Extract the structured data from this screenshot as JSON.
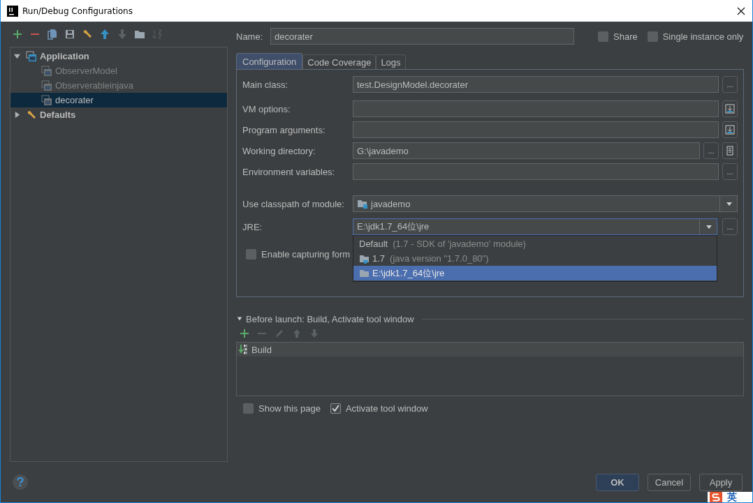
{
  "window": {
    "title": "Run/Debug Configurations"
  },
  "toolbar": [
    {
      "kind": "add",
      "disabled": false
    },
    {
      "kind": "remove",
      "disabled": false
    },
    {
      "kind": "copy",
      "disabled": false
    },
    {
      "kind": "save",
      "disabled": false
    },
    {
      "kind": "wrench",
      "disabled": false
    },
    {
      "kind": "up",
      "disabled": false
    },
    {
      "kind": "down",
      "disabled": true
    },
    {
      "kind": "folder",
      "disabled": false
    },
    {
      "kind": "sort",
      "disabled": true
    }
  ],
  "tree": [
    {
      "label": "Application",
      "kind": "application",
      "expanded": true,
      "selected": false,
      "children": [
        {
          "label": "ObserverModel",
          "selected": false
        },
        {
          "label": "Observerableinjava",
          "selected": false
        },
        {
          "label": "decorater",
          "selected": true
        }
      ]
    },
    {
      "label": "Defaults",
      "kind": "defaults",
      "expanded": false,
      "selected": false
    }
  ],
  "name": {
    "label": "Name:",
    "value": "decorater"
  },
  "options": [
    {
      "label": "Share",
      "checked": false
    },
    {
      "label": "Single instance only",
      "checked": false
    }
  ],
  "tabs": [
    {
      "label": "Configuration",
      "selected": true
    },
    {
      "label": "Code Coverage",
      "selected": false
    },
    {
      "label": "Logs",
      "selected": false
    }
  ],
  "fields": [
    {
      "label": "Main class:",
      "value": "test.DesignModel.decorater",
      "buttons": [
        {
          "kind": "ellipsis",
          "label": "..."
        }
      ]
    },
    {
      "label": "VM options:",
      "buttons": [
        {
          "kind": "expand"
        }
      ]
    },
    {
      "label": "Program arguments:",
      "buttons": [
        {
          "kind": "expand"
        }
      ]
    },
    {
      "label": "Working directory:",
      "value": "G:\\javademo",
      "buttons": [
        {
          "kind": "ellipsis",
          "label": "..."
        },
        {
          "kind": "macro"
        }
      ]
    },
    {
      "label": "Environment variables:",
      "buttons": [
        {
          "kind": "ellipsis",
          "label": "..."
        }
      ]
    }
  ],
  "classpath": {
    "label": "Use classpath of module:",
    "value": "javademo"
  },
  "jre": {
    "label": "JRE:",
    "value": "E:\\jdk1.7_64位\\jre",
    "button": "...",
    "options": [
      {
        "label": "Default",
        "detail": "(1.7 - SDK of 'javademo' module)",
        "kind": "default",
        "selected": false
      },
      {
        "label": "1.7",
        "detail": "(java version \"1.7.0_80\")",
        "kind": "jdk",
        "selected": false
      },
      {
        "label": "E:\\jdk1.7_64位\\jre",
        "kind": "folder",
        "selected": true
      }
    ]
  },
  "enable_capturing": {
    "label": "Enable capturing form",
    "checked": false
  },
  "before_launch": {
    "title": "Before launch: Build, Activate tool window",
    "expanded": true,
    "toolbar": [
      {
        "kind": "add",
        "disabled": false
      },
      {
        "kind": "remove",
        "disabled": true
      },
      {
        "kind": "edit",
        "disabled": true
      },
      {
        "kind": "up",
        "disabled": true
      },
      {
        "kind": "down",
        "disabled": true
      }
    ],
    "tasks": [
      {
        "label": "Build"
      }
    ]
  },
  "launch_options": [
    {
      "label": "Show this page",
      "checked": false
    },
    {
      "label": "Activate tool window",
      "checked": true
    }
  ],
  "buttons": [
    {
      "label": "OK",
      "kind": "default"
    },
    {
      "label": "Cancel",
      "kind": "normal"
    },
    {
      "label": "Apply",
      "kind": "normal"
    }
  ],
  "ime": {
    "label": "英"
  }
}
